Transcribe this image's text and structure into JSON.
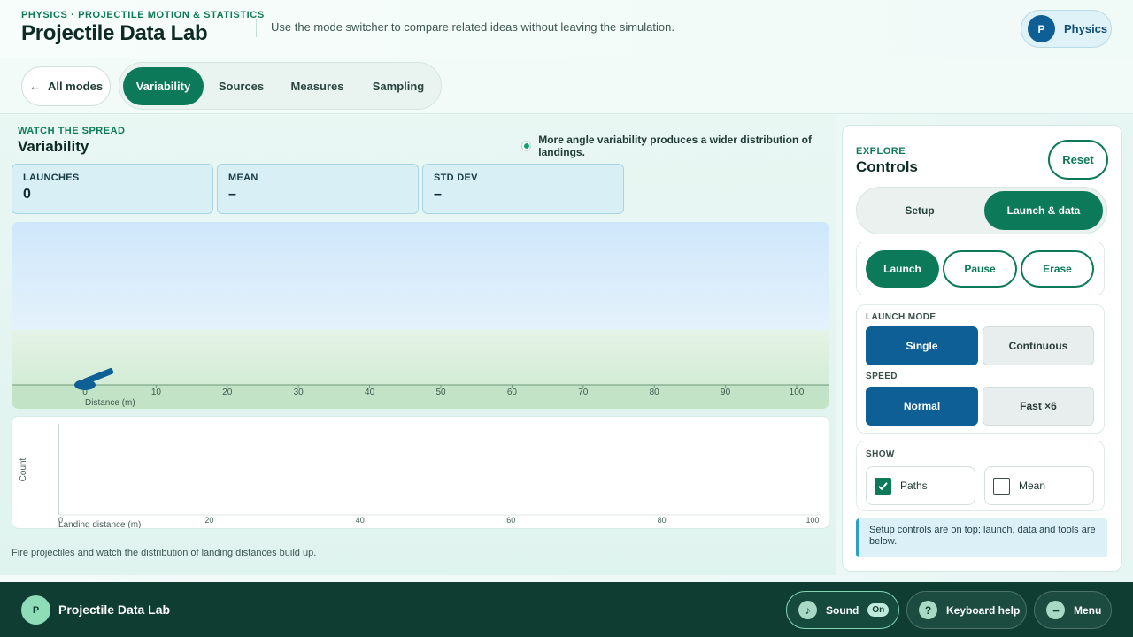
{
  "header": {
    "eyebrow": "PHYSICS · PROJECTILE MOTION & STATISTICS",
    "title": "Projectile Data Lab",
    "hint": "Use the mode switcher to compare related ideas without leaving the simulation.",
    "profile": {
      "initial": "P",
      "label": "Physics"
    }
  },
  "modebar": {
    "back_label": "All modes",
    "tabs": [
      {
        "label": "Variability",
        "active": true
      },
      {
        "label": "Sources",
        "active": false
      },
      {
        "label": "Measures",
        "active": false
      },
      {
        "label": "Sampling",
        "active": false
      }
    ]
  },
  "stage": {
    "eyebrow": "WATCH THE SPREAD",
    "title": "Variability",
    "note": "More angle variability produces a wider distribution of landings.",
    "stats": [
      {
        "label": "LAUNCHES",
        "value": "0"
      },
      {
        "label": "MEAN",
        "value": "–"
      },
      {
        "label": "STD DEV",
        "value": "–"
      }
    ],
    "field": {
      "xlabel": "Distance (m)",
      "ticks": [
        "0",
        "10",
        "20",
        "30",
        "40",
        "50",
        "60",
        "70",
        "80",
        "90",
        "100"
      ]
    },
    "histogram": {
      "ylabel": "Count",
      "xlabel": "Landing distance (m)",
      "ticks": [
        "0",
        "20",
        "40",
        "60",
        "80",
        "100"
      ]
    },
    "caption": "Fire projectiles and watch the distribution of landing distances build up."
  },
  "controls": {
    "eyebrow": "EXPLORE",
    "title": "Controls",
    "reset_label": "Reset",
    "segments": [
      {
        "label": "Setup",
        "active": false
      },
      {
        "label": "Launch & data",
        "active": true
      }
    ],
    "actions": {
      "launch": "Launch",
      "pause": "Pause",
      "erase": "Erase"
    },
    "launch_mode": {
      "label": "LAUNCH MODE",
      "options": [
        "Single",
        "Continuous"
      ],
      "selected": "Single"
    },
    "speed": {
      "label": "SPEED",
      "options": [
        "Normal",
        "Fast ×6"
      ],
      "selected": "Normal"
    },
    "show": {
      "label": "SHOW",
      "items": [
        {
          "label": "Paths",
          "checked": true
        },
        {
          "label": "Mean",
          "checked": false
        }
      ]
    },
    "info": "Setup controls are on top; launch, data and tools are below."
  },
  "footer": {
    "logo_initial": "P",
    "title": "Projectile Data Lab",
    "sound": {
      "label": "Sound",
      "state": "On",
      "icon": "♪"
    },
    "keyboard": {
      "label": "Keyboard help",
      "icon": "?"
    },
    "menu": {
      "label": "Menu",
      "icon": "•••"
    }
  },
  "colors": {
    "accent": "#0c7a58",
    "secondary": "#0e5f96",
    "footer_bg": "#0f3d31"
  }
}
